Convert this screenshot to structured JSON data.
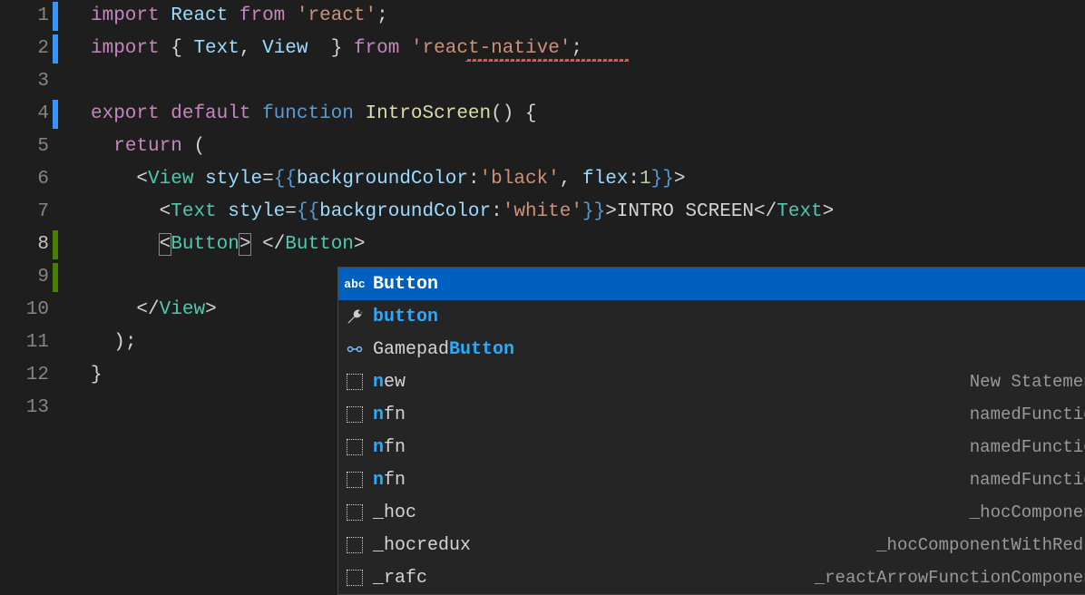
{
  "lines": [
    "1",
    "2",
    "3",
    "4",
    "5",
    "6",
    "7",
    "8",
    "9",
    "10",
    "11",
    "12",
    "13"
  ],
  "activeLine": 8,
  "decorations": {
    "1": "blue",
    "2": "blue",
    "4": "blue",
    "8": "green",
    "9": "green"
  },
  "code": {
    "l1": {
      "kw": "import",
      "ident": "React",
      "from": "from",
      "str": "'react'"
    },
    "l2": {
      "kw": "import",
      "ob": "{ ",
      "i1": "Text",
      "c": ", ",
      "i2": "View",
      "cb": "  } ",
      "from": "from",
      "str": "'react-native'"
    },
    "l4": {
      "kw1": "export",
      "kw2": "default",
      "kw3": "function",
      "fn": "IntroScreen",
      "paren": "() {"
    },
    "l5": {
      "kw": "return",
      "p": " ("
    },
    "l6": {
      "tag": "View",
      "attr": "style",
      "eq": "=",
      "ob": "{{",
      "p1": "backgroundColor",
      "c": ":",
      "v1": "'black'",
      "cm": ", ",
      "p2": "flex",
      "v2": "1",
      "cb": "}}",
      "gt": ">"
    },
    "l7": {
      "tag": "Text",
      "attr": "style",
      "eq": "=",
      "ob": "{{",
      "p1": "backgroundColor",
      "c": ":",
      "v1": "'white'",
      "cb": "}}",
      "gt": ">",
      "txt": "INTRO SCREEN",
      "ctag": "Text"
    },
    "l8": {
      "tag": "Button",
      "sp": " ",
      "ctag": "Button"
    },
    "l10": {
      "tag": "View"
    },
    "l11": {
      "p": ");"
    },
    "l12": {
      "p": "}"
    }
  },
  "suggest": [
    {
      "icon": "abc",
      "label_pre": "",
      "label_hl": "Button",
      "label_post": "",
      "detail": "",
      "selected": true
    },
    {
      "icon": "wrench",
      "label_pre": "",
      "label_hl": "button",
      "label_post": "",
      "detail": ""
    },
    {
      "icon": "interface",
      "label_pre": "Gamepad",
      "label_hl": "Button",
      "label_post": "",
      "detail": ""
    },
    {
      "icon": "box",
      "label_pre": "",
      "label_hl": "n",
      "label_post": "ew",
      "detail": "New Statement"
    },
    {
      "icon": "box",
      "label_pre": "",
      "label_hl": "n",
      "label_post": "fn",
      "detail": "namedFunction"
    },
    {
      "icon": "box",
      "label_pre": "",
      "label_hl": "n",
      "label_post": "fn",
      "detail": "namedFunction"
    },
    {
      "icon": "box",
      "label_pre": "",
      "label_hl": "n",
      "label_post": "fn",
      "detail": "namedFunction"
    },
    {
      "icon": "box",
      "label_pre": "_hoc",
      "label_hl": "",
      "label_post": "",
      "detail": "_hocComponent"
    },
    {
      "icon": "box",
      "label_pre": "_hocredux",
      "label_hl": "",
      "label_post": "",
      "detail": "_hocComponentWithRedux"
    },
    {
      "icon": "box",
      "label_pre": "_rafc",
      "label_hl": "",
      "label_post": "",
      "detail": "_reactArrowFunctionComponent"
    }
  ]
}
